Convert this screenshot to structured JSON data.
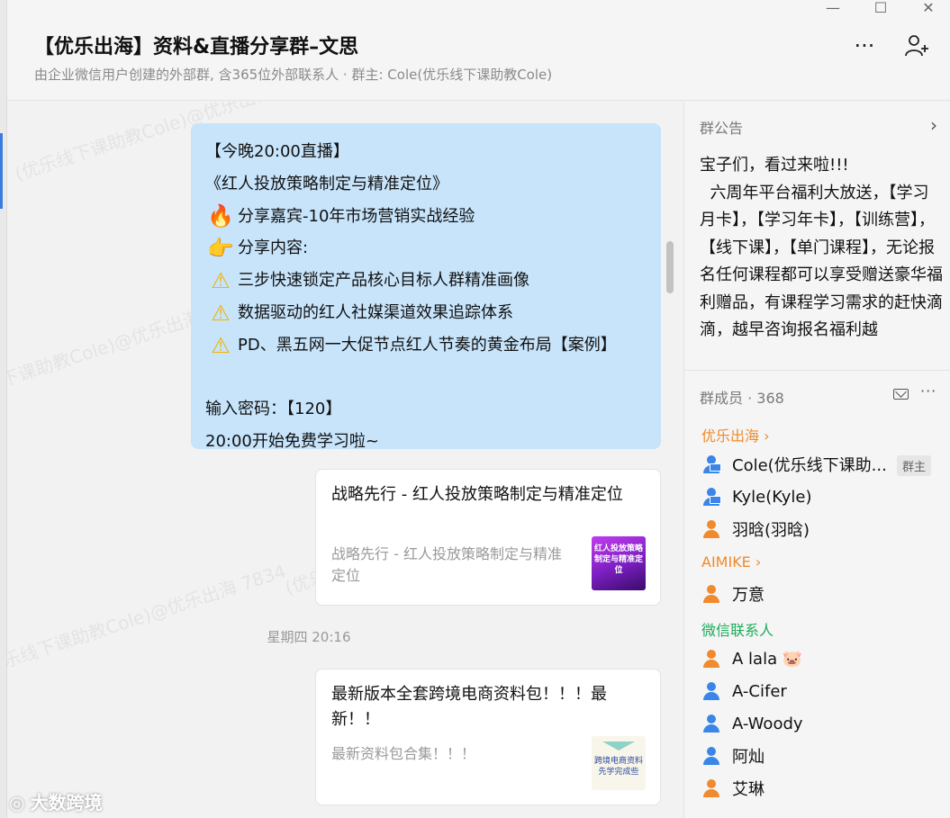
{
  "window": {
    "minimize_icon": "—",
    "maximize_icon": "☐",
    "close_icon": "✕"
  },
  "header": {
    "title": "【优乐出海】资料&直播分享群–文思",
    "subtitle": "由企业微信用户创建的外部群, 含365位外部联系人 · 群主: Cole(优乐线下课助教Cole)",
    "more_icon": "···",
    "add_member_icon": "person-plus-icon"
  },
  "messages": {
    "live_notice": {
      "lines": [
        {
          "emoji": "",
          "text": "【今晚20:00直播】"
        },
        {
          "emoji": "",
          "text": "《红人投放策略制定与精准定位》"
        },
        {
          "emoji": "🔥",
          "text": "分享嘉宾-10年市场营销实战经验"
        },
        {
          "emoji": "👉",
          "text": "分享内容:"
        },
        {
          "emoji": "⚠",
          "text": "三步快速锁定产品核心目标人群精准画像"
        },
        {
          "emoji": "⚠",
          "text": "数据驱动的红人社媒渠道效果追踪体系"
        },
        {
          "emoji": "⚠",
          "text": "PD、黑五网一大促节点红人节奏的黄金布局【案例】"
        },
        {
          "emoji": "",
          "text": ""
        },
        {
          "emoji": "",
          "text": "输入密码：【120】"
        },
        {
          "emoji": "",
          "text": "20:00开始免费学习啦~"
        }
      ]
    },
    "card1": {
      "title": "战略先行 - 红人投放策略制定与精准定位",
      "desc": "战略先行 - 红人投放策略制定与精准定位",
      "thumb_text": "红人投放策略制定与精准定位"
    },
    "timestamp": "星期四 20:16",
    "card2": {
      "title": "最新版本全套跨境电商资料包！！！最新！！",
      "desc": "最新资料包合集！！！",
      "thumb_text": "跨境电商资料 先学完成些"
    }
  },
  "watermark": "(优乐线下课助教Cole)@优乐出海 7834",
  "brand": "大数跨境",
  "sidebar": {
    "notice_heading": "群公告",
    "notice_text": "宝子们，看过来啦!!!\n  六周年平台福利大放送，【学习月卡】，【学习年卡】，【训练营】，【线下课】，【单门课程】，无论报名任何课程都可以享受赠送豪华福利赠品，有课程学习需求的赶快滴滴，越早咨询报名福利越",
    "members_heading": "群成员 · 368",
    "groups": [
      {
        "name": "优乐出海 ›",
        "color": "#ef8a2b",
        "members": [
          {
            "name": "Cole(优乐线下课助...",
            "avatar": "blue-monitor",
            "tag": "群主"
          },
          {
            "name": "Kyle(Kyle)",
            "avatar": "blue-monitor",
            "tag": ""
          },
          {
            "name": "羽晗(羽晗)",
            "avatar": "orange",
            "tag": ""
          }
        ]
      },
      {
        "name": "AIMIKE ›",
        "color": "#ef8a2b",
        "members": [
          {
            "name": "万意",
            "avatar": "orange",
            "tag": ""
          }
        ]
      },
      {
        "name": "微信联系人",
        "color": "#1aad5a",
        "members": [
          {
            "name": "A    lala 🐷",
            "avatar": "orange",
            "tag": ""
          },
          {
            "name": "A-Cifer",
            "avatar": "blue",
            "tag": ""
          },
          {
            "name": "A-Woody",
            "avatar": "blue",
            "tag": ""
          },
          {
            "name": "阿灿",
            "avatar": "blue",
            "tag": ""
          },
          {
            "name": "艾琳",
            "avatar": "orange",
            "tag": ""
          }
        ]
      }
    ]
  }
}
